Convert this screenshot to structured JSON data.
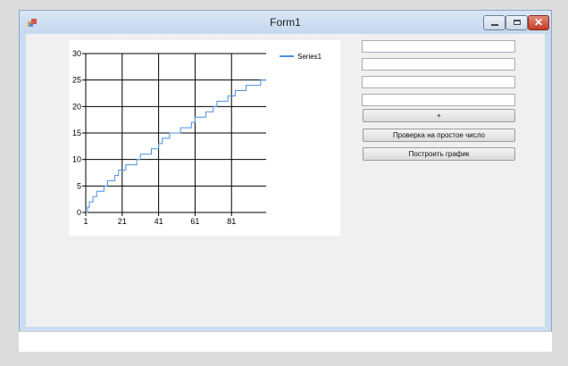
{
  "window": {
    "title": "Form1",
    "icon": "app-icon",
    "controls": {
      "minimize": "minimize-icon",
      "maximize": "maximize-icon",
      "close": "close-icon",
      "close_glyph": "✕"
    }
  },
  "inputs": [
    {
      "value": "",
      "placeholder": ""
    },
    {
      "value": "",
      "placeholder": ""
    },
    {
      "value": "",
      "placeholder": ""
    },
    {
      "value": "",
      "placeholder": ""
    }
  ],
  "buttons": {
    "plus": "+",
    "check_prime": "Проверка на простое число",
    "build_chart": "Построить график"
  },
  "chart_data": {
    "type": "line",
    "title": "",
    "xlabel": "",
    "ylabel": "",
    "xlim": [
      1,
      100
    ],
    "ylim": [
      0,
      30
    ],
    "x_ticks": [
      "1",
      "21",
      "41",
      "61",
      "81"
    ],
    "y_ticks": [
      "0",
      "5",
      "10",
      "15",
      "20",
      "25",
      "30"
    ],
    "grid": true,
    "legend": "top-right",
    "series": [
      {
        "name": "Series1",
        "color": "#4a90e2",
        "x": [
          1,
          2,
          3,
          5,
          7,
          11,
          13,
          17,
          19,
          23,
          29,
          31,
          37,
          41,
          43,
          47,
          53,
          59,
          61,
          67,
          71,
          73,
          79,
          83,
          89,
          97,
          100
        ],
        "values": [
          0,
          1,
          2,
          3,
          4,
          5,
          6,
          7,
          8,
          9,
          10,
          11,
          12,
          13,
          14,
          15,
          16,
          17,
          18,
          19,
          20,
          21,
          22,
          23,
          24,
          25,
          25
        ]
      }
    ]
  }
}
